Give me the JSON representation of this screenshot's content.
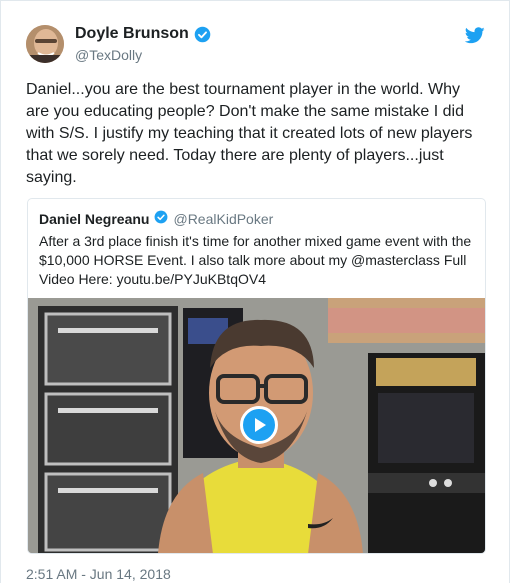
{
  "tweet": {
    "display_name": "Doyle Brunson",
    "handle": "@TexDolly",
    "text": "Daniel...you are the best tournament player in the world. Why are you educating people? Don't make the same mistake I did with S/S. I justify my teaching that it created lots of new players that we sorely need. Today there are plenty of players...just saying.",
    "timestamp": "2:51 AM - Jun 14, 2018",
    "verified_icon": "verified-badge-icon",
    "brand_icon": "twitter-bird-icon"
  },
  "quoted_tweet": {
    "display_name": "Daniel Negreanu",
    "handle": "@RealKidPoker",
    "text": "After a 3rd place finish it's time for another mixed game event with the $10,000 HORSE Event. I also talk more about my @masterclass Full Video Here: youtu.be/PYJuKBtqOV4",
    "video_icon": "play-icon"
  },
  "colors": {
    "accent": "#1da1f2",
    "text": "#1c2022",
    "muted": "#697882",
    "border": "#e1e8ed"
  }
}
